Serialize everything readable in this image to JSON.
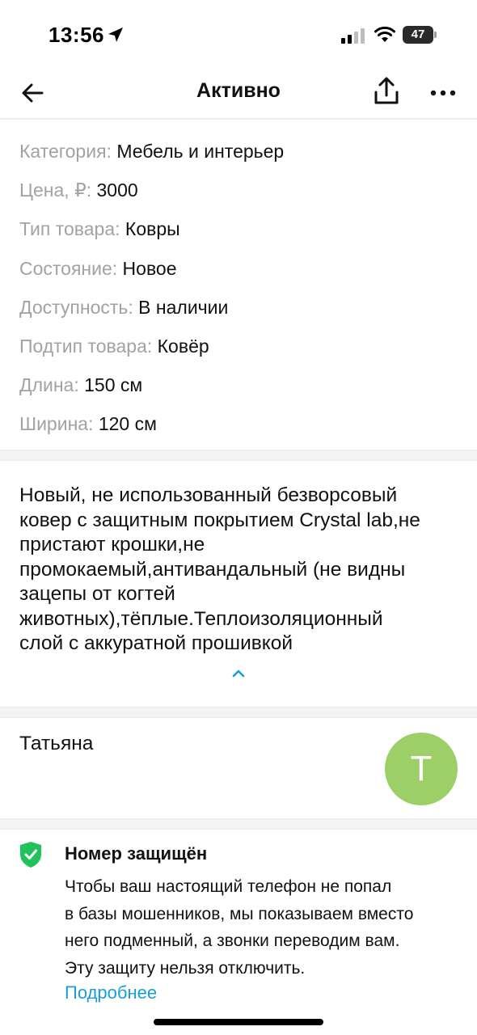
{
  "status_bar": {
    "time": "13:56",
    "battery": "47",
    "icons": [
      "location-arrow-icon",
      "signal-icon",
      "wifi-icon",
      "battery-icon"
    ]
  },
  "nav": {
    "title": "Активно",
    "back_icon": "arrow-left-icon",
    "share_icon": "share-icon",
    "more_icon": "more-horizontal-icon"
  },
  "params": [
    {
      "key": "Категория:",
      "value": "Мебель и интерьер"
    },
    {
      "key": "Цена, ₽:",
      "value": "3000"
    },
    {
      "key": "Тип товара:",
      "value": "Ковры"
    },
    {
      "key": "Состояние:",
      "value": "Новое"
    },
    {
      "key": "Доступность:",
      "value": "В наличии"
    },
    {
      "key": "Подтип товара:",
      "value": "Ковёр"
    },
    {
      "key": "Длина:",
      "value": "150 см"
    },
    {
      "key": "Ширина:",
      "value": "120 см"
    }
  ],
  "description": {
    "lines": [
      "Новый, не использованный безворсовый",
      "ковер с защитным покрытием Crystal lab,не",
      "пристают крошки,не",
      "промокаемый,антивандальный (не видны",
      "зацепы от когтей",
      "животных),тёплые.Теплоизоляционный",
      "слой с аккуратной прошивкой"
    ],
    "collapse_icon": "chevron-up-icon"
  },
  "seller": {
    "name": "Татьяна",
    "avatar_letter": "Т",
    "avatar_color": "#9ccf66"
  },
  "protection": {
    "title": "Номер защищён",
    "text_lines": [
      "Чтобы ваш настоящий телефон не попал",
      "в базы мошенников, мы показываем вместо",
      "него подменный, а звонки переводим вам.",
      "Эту защиту нельзя отключить."
    ],
    "link": "Подробнее",
    "icon": "shield-check-icon"
  },
  "colors": {
    "accent_link": "#1a9bdc",
    "muted_label": "#a2a2a2",
    "shield_green": "#1fc35a"
  }
}
